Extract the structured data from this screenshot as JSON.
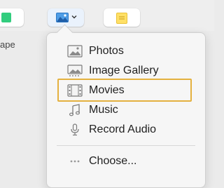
{
  "toolbar": {
    "shape_label": "ape",
    "shape_color": "#32cd7e",
    "media_icon": "photo-icon",
    "comment_color": "#ffe066"
  },
  "menu": {
    "items": [
      {
        "label": "Photos",
        "icon": "photos-icon"
      },
      {
        "label": "Image Gallery",
        "icon": "image-gallery-icon"
      },
      {
        "label": "Movies",
        "icon": "movie-icon"
      },
      {
        "label": "Music",
        "icon": "music-note-icon"
      },
      {
        "label": "Record Audio",
        "icon": "microphone-icon"
      }
    ],
    "choose": {
      "label": "Choose...",
      "icon": "ellipsis-icon"
    }
  },
  "highlight_color": "#e4b13f"
}
